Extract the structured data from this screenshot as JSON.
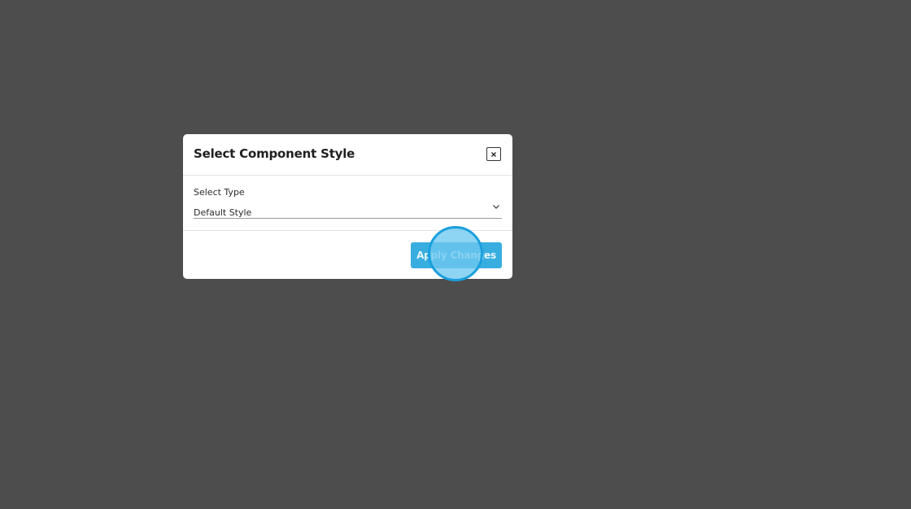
{
  "modal": {
    "title": "Select Component Style",
    "close_icon": "close-icon",
    "field": {
      "label": "Select Type",
      "selected_value": "Default Style",
      "dropdown_icon": "chevron-down-icon"
    },
    "apply_label": "Apply Changes"
  },
  "colors": {
    "backdrop": "#4d4d4d",
    "accent": "#38aee0",
    "click_indicator": "#1a9fdc"
  }
}
